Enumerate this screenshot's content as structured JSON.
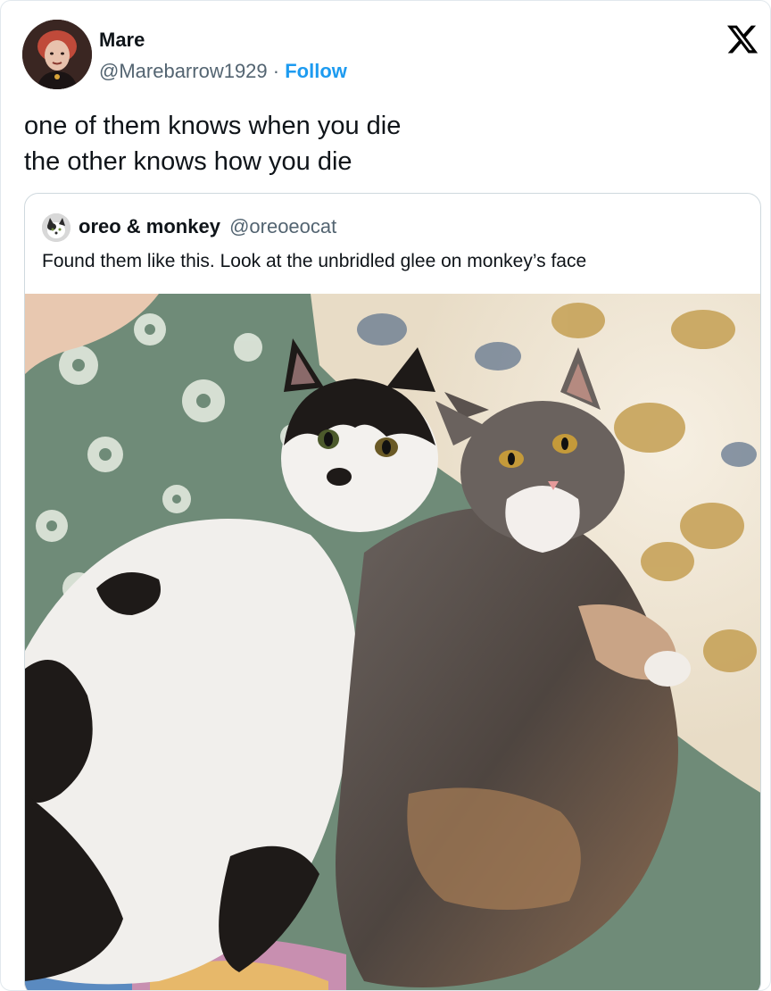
{
  "author": {
    "name": "Mare",
    "handle": "@Marebarrow1929",
    "separator": "·",
    "follow_label": "Follow"
  },
  "brand": {
    "icon": "x-logo-icon",
    "color": "#000000"
  },
  "tweet": {
    "lines": [
      "one of them knows when you die",
      "the other knows how you die"
    ]
  },
  "quoted": {
    "name": "oreo & monkey",
    "handle": "@oreoeocat",
    "text": "Found them like this. Look at the unbridled glee on monkey’s face",
    "image_icon": "cats-photo"
  },
  "colors": {
    "text": "#0f1419",
    "secondary": "#536471",
    "link": "#1d9bf0",
    "border": "#cfd9de"
  }
}
